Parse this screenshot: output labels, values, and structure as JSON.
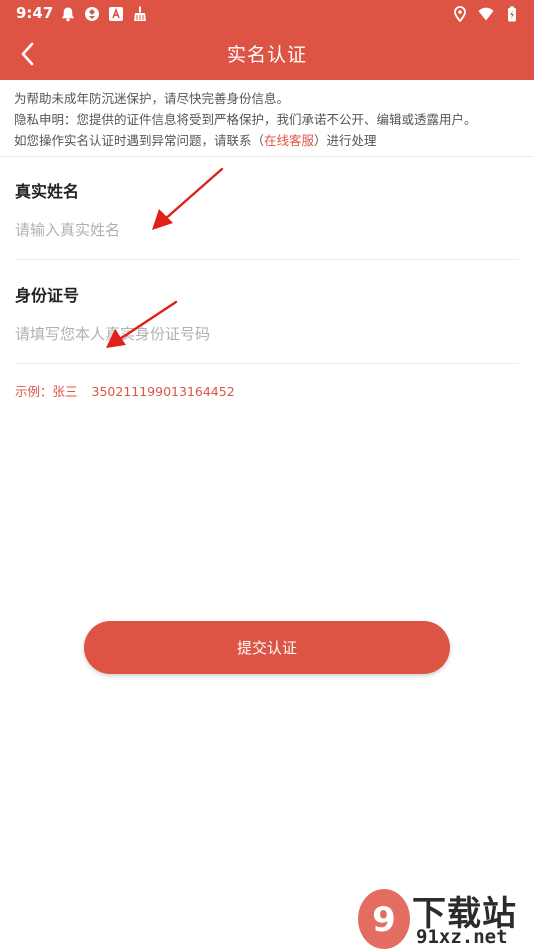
{
  "status_bar": {
    "time": "9:47"
  },
  "header": {
    "title": "实名认证",
    "color": "#de5444"
  },
  "notice": {
    "line1": "为帮助未成年防沉迷保护，请尽快完善身份信息。",
    "line2": "隐私申明：您提供的证件信息将受到严格保护，我们承诺不公开、编辑或透露用户。",
    "line3_prefix": "如您操作实名认证时遇到异常问题，请联系（",
    "line3_link": "在线客服",
    "line3_suffix": "）进行处理"
  },
  "form": {
    "name": {
      "label": "真实姓名",
      "placeholder": "请输入真实姓名",
      "value": ""
    },
    "id_number": {
      "label": "身份证号",
      "placeholder": "请填写您本人真实身份证号码",
      "value": ""
    },
    "example_prefix": "示例：张三",
    "example_number": "350211199013164452"
  },
  "submit": {
    "label": "提交认证"
  },
  "watermark": {
    "text_top": "下载站",
    "text_bottom": "91xz.net"
  },
  "icons": {
    "back": "chevron-left-icon",
    "status_left": [
      "bell-icon",
      "shutter-icon",
      "a-badge-icon",
      "broom-icon"
    ],
    "status_right": [
      "location-icon",
      "wifi-icon",
      "battery-icon"
    ]
  }
}
